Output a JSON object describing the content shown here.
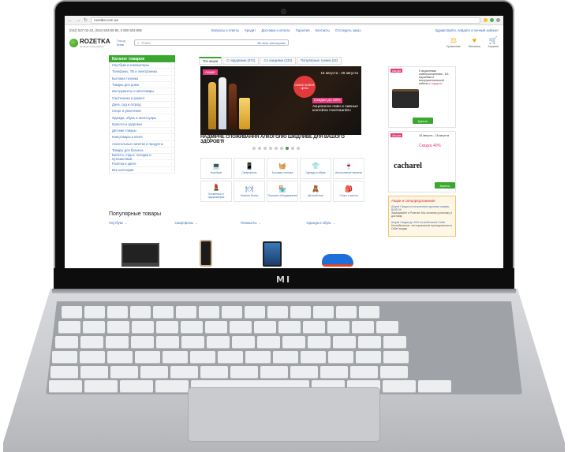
{
  "device": {
    "brand": "MI"
  },
  "browser": {
    "url": "rozetka.com.ua"
  },
  "topline": {
    "phones": "(044) 537-02-22, (044) 503-80-80, 0 800 503-808",
    "links": [
      "Вопросы и ответы",
      "Кредит",
      "Доставка и оплата",
      "Гарантия",
      "Контакты",
      "Магазины"
    ],
    "city_link": "Отследить заказ",
    "account": "Здравствуйте, войдите в личный кабинет"
  },
  "header": {
    "logo": "ROZETKA",
    "logo_sub": "интернет-супермаркет",
    "city_label": "Город",
    "city": "Киев",
    "search_placeholder": "Поиск",
    "search_category": "Во всех категориях",
    "icons": [
      {
        "name": "compare",
        "glyph": "⚖",
        "label": "Сравнение"
      },
      {
        "name": "wishlist",
        "glyph": "♥",
        "label": "Желания"
      },
      {
        "name": "cart",
        "glyph": "🛒",
        "label": "Корзина"
      }
    ]
  },
  "sidebar": {
    "title": "Каталог товаров",
    "items": [
      "Ноутбуки и компьютеры",
      "Телефоны, ТВ и электроника",
      "Бытовая техника",
      "Товары для дома",
      "Инструменты и автотовары",
      "Сантехника и ремонт",
      "Дача, сад и огород",
      "Спорт и увлечения",
      "Одежда, обувь и аксессуары",
      "Красота и здоровье",
      "Детские товары",
      "Канцтовары и книги",
      "Алкогольные напитки и продукты",
      "Товары для бизнеса",
      "Билеты, отдых, поездки и путешествия",
      "Розетка в цвете",
      "Все категории"
    ]
  },
  "tabs": [
    "Топ акции",
    "С подарками (371)",
    "Со скидками (232)",
    "Популярные туники (22)"
  ],
  "hero": {
    "flag": "Акция",
    "dates": "15 августа - 29 августа",
    "badge": "САМЫЕ НИЗКИЕ ЦЕНЫ",
    "offer_hl": "Скидки до 20%",
    "offer_text": "Акционное пиво и пивные коктейли HoeGaarden",
    "warning": "НАДМІРНЕ СПОЖИВАННЯ АЛКОГОЛЮ ШКІДЛИВЕ ДЛЯ ВАШОГО ЗДОРОВ'Я"
  },
  "slider": {
    "count": 9,
    "active": 7
  },
  "tiles": [
    {
      "icon": "laptop-icon",
      "glyph": "💻",
      "label": "Ноутбуки"
    },
    {
      "icon": "phone-icon",
      "glyph": "📱",
      "label": "Смартфоны"
    },
    {
      "icon": "washer-icon",
      "glyph": "🧺",
      "label": "Бытовая техника"
    },
    {
      "icon": "clothes-icon",
      "glyph": "👕",
      "label": "Одежда и обувь"
    },
    {
      "icon": "wine-icon",
      "glyph": "🍷",
      "label": "Алкогольные напитки"
    },
    {
      "icon": "cosmetics-icon",
      "glyph": "💄",
      "label": "Косметика и парфюмерия"
    },
    {
      "icon": "tableware-icon",
      "glyph": "🍽",
      "label": "Нижнее белье"
    },
    {
      "icon": "shop-icon",
      "glyph": "🏪",
      "label": "Торговое оборудование"
    },
    {
      "icon": "toy-icon",
      "glyph": "🧸",
      "label": "Детский мир"
    },
    {
      "icon": "school-icon",
      "glyph": "🎒",
      "label": "Спорт и школа"
    }
  ],
  "popular": {
    "title": "Популярные товары",
    "cols": [
      {
        "link": "Ноутбуки →",
        "img": "laptop"
      },
      {
        "link": "Смартфоны →",
        "img": "phone"
      },
      {
        "link": "Планшеты →",
        "img": "tablet"
      },
      {
        "link": "Одежда и обувь →",
        "img": "crocs"
      }
    ]
  },
  "right": {
    "promos": [
      {
        "flag": "Акция",
        "text": "К акционным комбоусилителям - DJ-наушники и инструментальный кабель",
        "red": "в подарок!",
        "button": "Купить",
        "brand": ""
      },
      {
        "flag": "Акция",
        "text": "16 августа - 18 августа",
        "red": "Скидка 40%",
        "button": "Купить",
        "brand": "cacharel"
      }
    ],
    "deals_title": "Акции и спецпредложения",
    "deals": [
      {
        "link": "Акция! Скидки на встроенные духовые шкафы BOSCH!",
        "text": "Заказывайте в Розетке! Мы оплатим установку и доставку"
      },
      {
        "link": "Акция! Скидки до 20% на мобильные Celler",
        "text": "На мобильные, тенториальные принадлежности Celler скидки"
      }
    ]
  }
}
